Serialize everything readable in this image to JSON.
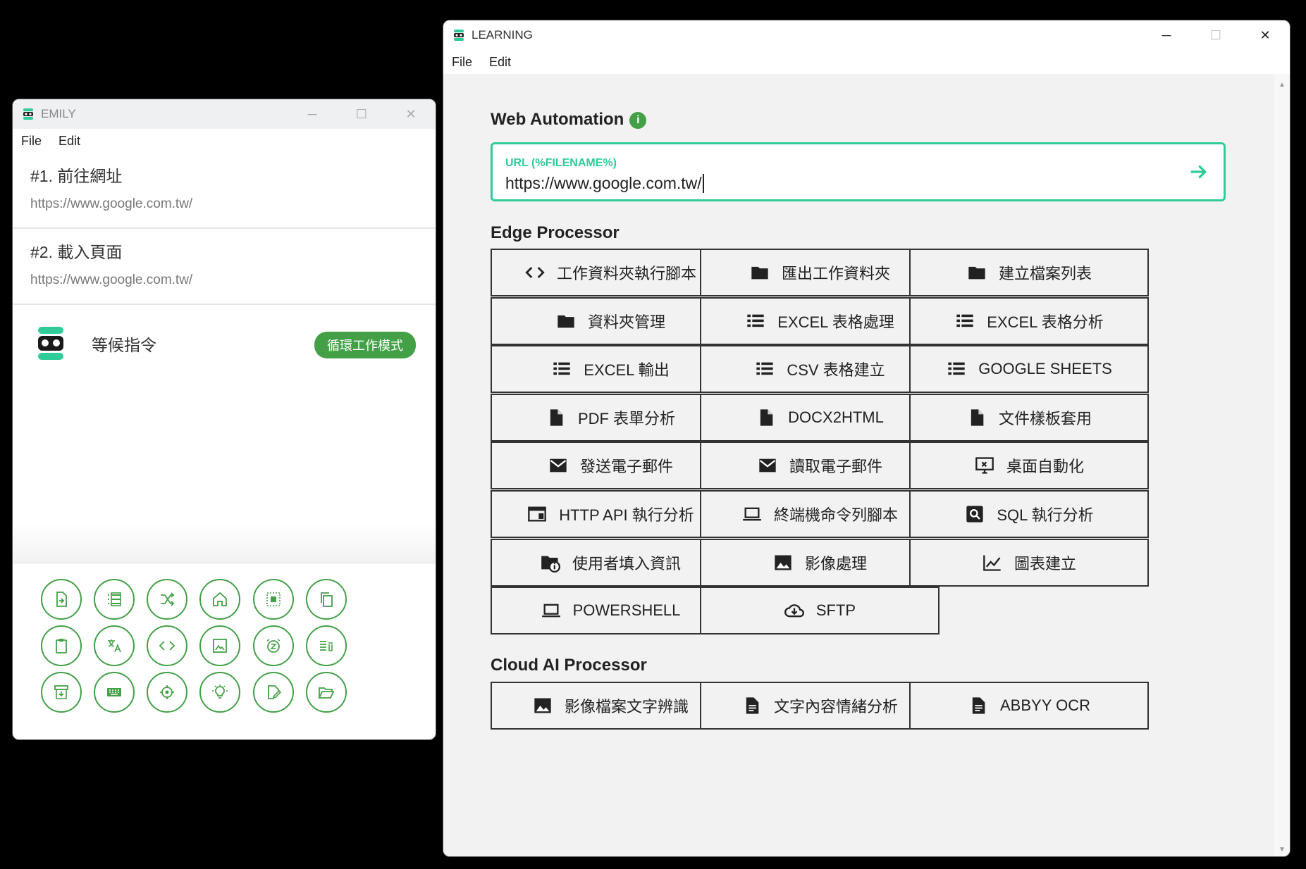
{
  "emily": {
    "title": "EMILY",
    "menu": [
      "File",
      "Edit"
    ],
    "steps": [
      {
        "title": "#1. 前往網址",
        "url": "https://www.google.com.tw/"
      },
      {
        "title": "#2. 載入頁面",
        "url": "https://www.google.com.tw/"
      }
    ],
    "status_text": "等候指令",
    "mode_badge": "循環工作模式",
    "tools": [
      "file-export-icon",
      "list-icon",
      "shuffle-icon",
      "home-icon",
      "select-all-icon",
      "copy-icon",
      "clipboard-icon",
      "translate-icon",
      "code-icon",
      "image-frame-icon",
      "alarm-icon",
      "delete-list-icon",
      "archive-icon",
      "keyboard-icon",
      "crosshair-icon",
      "lightbulb-icon",
      "edit-file-icon",
      "folder-open-icon"
    ]
  },
  "learning": {
    "title": "LEARNING",
    "menu": [
      "File",
      "Edit"
    ],
    "web_automation": {
      "heading": "Web Automation",
      "url_label": "URL (%FILENAME%)",
      "url_value": "https://www.google.com.tw/"
    },
    "edge_heading": "Edge Processor",
    "edge_buttons": [
      {
        "label": "工作資料夾執行腳本",
        "icon": "code-icon"
      },
      {
        "label": "匯出工作資料夾",
        "icon": "folder-icon"
      },
      {
        "label": "建立檔案列表",
        "icon": "folder-icon"
      },
      {
        "label": "資料夾管理",
        "icon": "folder-icon"
      },
      {
        "label": "EXCEL 表格處理",
        "icon": "list-icon"
      },
      {
        "label": "EXCEL 表格分析",
        "icon": "list-icon"
      },
      {
        "label": "EXCEL 輸出",
        "icon": "list-icon"
      },
      {
        "label": "CSV 表格建立",
        "icon": "list-icon"
      },
      {
        "label": "GOOGLE SHEETS",
        "icon": "list-icon"
      },
      {
        "label": "PDF 表單分析",
        "icon": "file-icon"
      },
      {
        "label": "DOCX2HTML",
        "icon": "file-icon"
      },
      {
        "label": "文件樣板套用",
        "icon": "file-icon"
      },
      {
        "label": "發送電子郵件",
        "icon": "mail-icon"
      },
      {
        "label": "讀取電子郵件",
        "icon": "mail-icon"
      },
      {
        "label": "桌面自動化",
        "icon": "desktop-icon"
      },
      {
        "label": "HTTP API 執行分析",
        "icon": "web-icon"
      },
      {
        "label": "終端機命令列腳本",
        "icon": "laptop-icon"
      },
      {
        "label": "SQL 執行分析",
        "icon": "search-box-icon"
      },
      {
        "label": "使用者填入資訊",
        "icon": "folder-info-icon"
      },
      {
        "label": "影像處理",
        "icon": "image-icon"
      },
      {
        "label": "圖表建立",
        "icon": "chart-icon"
      },
      {
        "label": "POWERSHELL",
        "icon": "laptop-icon"
      },
      {
        "label": "SFTP",
        "icon": "cloud-download-icon"
      }
    ],
    "cloud_heading": "Cloud AI Processor",
    "cloud_buttons": [
      {
        "label": "影像檔案文字辨識",
        "icon": "image-icon"
      },
      {
        "label": "文字內容情緒分析",
        "icon": "document-icon"
      },
      {
        "label": "ABBYY OCR",
        "icon": "document-icon"
      }
    ]
  },
  "colors": {
    "accent": "#43a047",
    "teal": "#2ecc9a"
  }
}
